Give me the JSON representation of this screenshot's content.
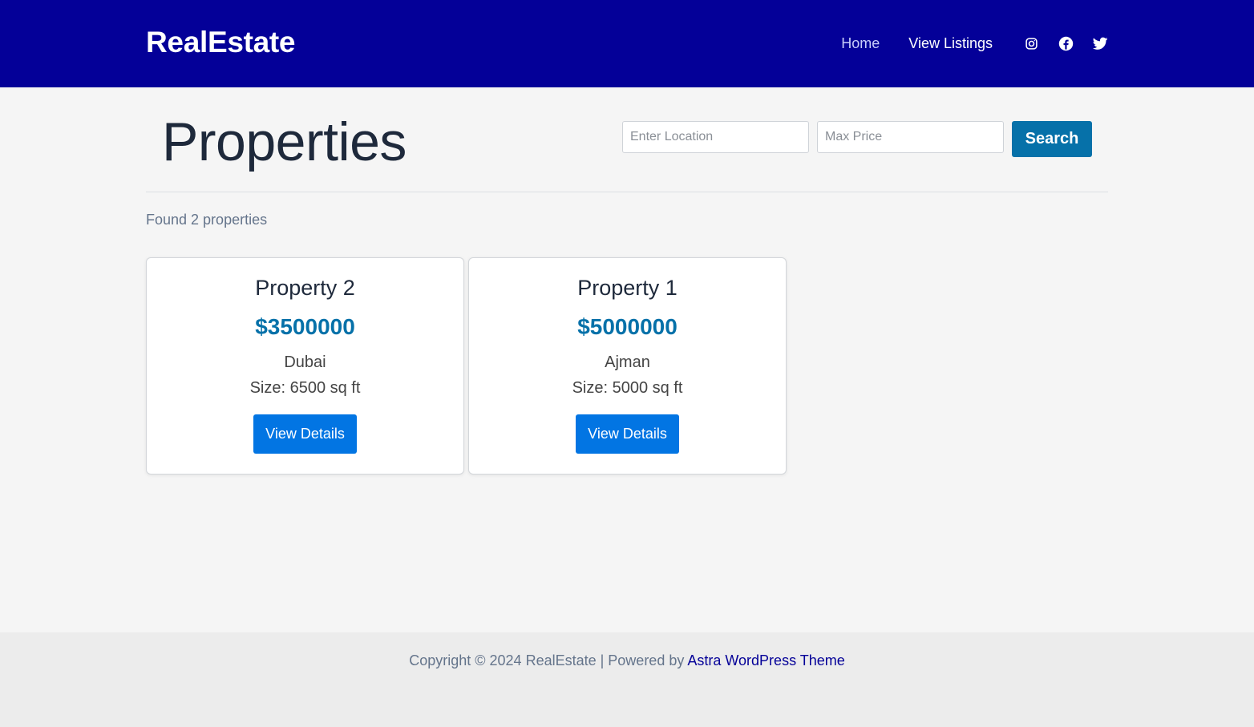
{
  "header": {
    "logo": "RealEstate",
    "nav": {
      "home": "Home",
      "listings": "View Listings"
    },
    "social": [
      "instagram-icon",
      "facebook-icon",
      "twitter-icon"
    ]
  },
  "main": {
    "title": "Properties",
    "search": {
      "location_placeholder": "Enter Location",
      "price_placeholder": "Max Price",
      "button_label": "Search"
    },
    "found_text": "Found 2 properties",
    "properties": [
      {
        "title": "Property 2",
        "price": "$3500000",
        "location": "Dubai",
        "size": "Size: 6500 sq ft",
        "button": "View Details"
      },
      {
        "title": "Property 1",
        "price": "$5000000",
        "location": "Ajman",
        "size": "Size: 5000 sq ft",
        "button": "View Details"
      }
    ]
  },
  "footer": {
    "text": "Copyright © 2024 RealEstate | Powered by ",
    "link": "Astra WordPress Theme"
  },
  "colors": {
    "header_bg": "#040098",
    "accent": "#0671a9",
    "button": "#0275e3"
  }
}
